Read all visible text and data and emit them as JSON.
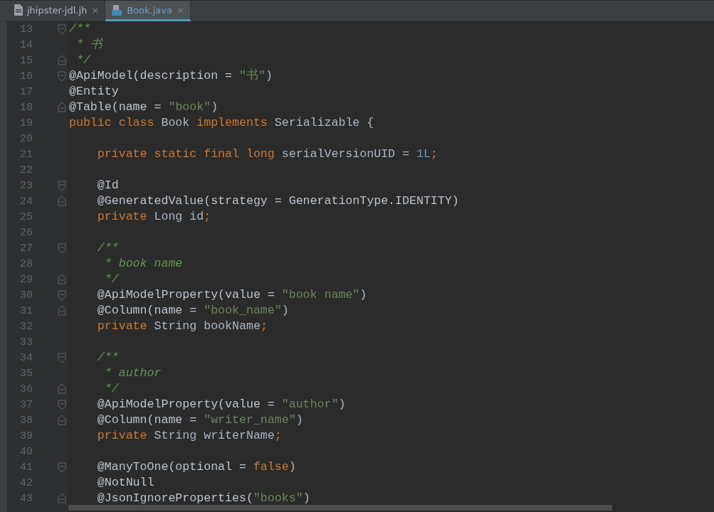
{
  "tabs": [
    {
      "label": "jhipster-jdl.jh",
      "kind": "text",
      "selected": false,
      "close": "×"
    },
    {
      "label": "Book.java",
      "kind": "java",
      "selected": true,
      "close": "×"
    }
  ],
  "editor": {
    "lines": [
      {
        "number": "13",
        "kind": "fold-start",
        "tokens": [
          {
            "kind": "comment",
            "text": "/**"
          }
        ]
      },
      {
        "number": "14",
        "kind": "plain",
        "tokens": [
          {
            "kind": "comment",
            "text": " * 书"
          }
        ]
      },
      {
        "number": "15",
        "kind": "fold-end",
        "tokens": [
          {
            "kind": "comment",
            "text": " */"
          }
        ]
      },
      {
        "number": "16",
        "kind": "fold-start",
        "tokens": [
          {
            "kind": "annotation",
            "text": "@ApiModel(description = "
          },
          {
            "kind": "string",
            "text": "\"书\""
          },
          {
            "kind": "plain",
            "text": ")"
          }
        ]
      },
      {
        "number": "17",
        "kind": "plain",
        "tokens": [
          {
            "kind": "annotation",
            "text": "@Entity"
          }
        ]
      },
      {
        "number": "18",
        "kind": "fold-end",
        "tokens": [
          {
            "kind": "annotation",
            "text": "@Table(name = "
          },
          {
            "kind": "string",
            "text": "\"book\""
          },
          {
            "kind": "plain",
            "text": ")"
          }
        ]
      },
      {
        "number": "19",
        "kind": "plain",
        "tokens": [
          {
            "kind": "keyword",
            "text": "public class "
          },
          {
            "kind": "plain",
            "text": "Book "
          },
          {
            "kind": "keyword",
            "text": "implements "
          },
          {
            "kind": "plain",
            "text": "Serializable {"
          }
        ]
      },
      {
        "number": "20",
        "kind": "plain"
      },
      {
        "number": "21",
        "kind": "plain",
        "tokens": [
          {
            "kind": "keyword",
            "text": "    private static final long "
          },
          {
            "kind": "plain",
            "text": "serialVersionUID = "
          },
          {
            "kind": "number",
            "text": "1L"
          },
          {
            "kind": "keyword",
            "text": ";"
          }
        ]
      },
      {
        "number": "22",
        "kind": "plain"
      },
      {
        "number": "23",
        "kind": "fold-start",
        "tokens": [
          {
            "kind": "annotation",
            "text": "    @Id"
          }
        ]
      },
      {
        "number": "24",
        "kind": "fold-end",
        "tokens": [
          {
            "kind": "annotation",
            "text": "    @GeneratedValue(strategy = GenerationType.IDENTITY)"
          }
        ]
      },
      {
        "number": "25",
        "kind": "plain",
        "tokens": [
          {
            "kind": "keyword",
            "text": "    private "
          },
          {
            "kind": "plain",
            "text": "Long id"
          },
          {
            "kind": "keyword",
            "text": ";"
          }
        ]
      },
      {
        "number": "26",
        "kind": "plain"
      },
      {
        "number": "27",
        "kind": "fold-start",
        "tokens": [
          {
            "kind": "comment",
            "text": "    /**"
          }
        ]
      },
      {
        "number": "28",
        "kind": "plain",
        "tokens": [
          {
            "kind": "comment",
            "text": "     * book name"
          }
        ]
      },
      {
        "number": "29",
        "kind": "fold-end",
        "tokens": [
          {
            "kind": "comment",
            "text": "     */"
          }
        ]
      },
      {
        "number": "30",
        "kind": "fold-start",
        "tokens": [
          {
            "kind": "annotation",
            "text": "    @ApiModelProperty(value = "
          },
          {
            "kind": "string",
            "text": "\"book name\""
          },
          {
            "kind": "plain",
            "text": ")"
          }
        ]
      },
      {
        "number": "31",
        "kind": "fold-end",
        "tokens": [
          {
            "kind": "annotation",
            "text": "    @Column(name = "
          },
          {
            "kind": "string",
            "text": "\"book_name\""
          },
          {
            "kind": "plain",
            "text": ")"
          }
        ]
      },
      {
        "number": "32",
        "kind": "plain",
        "tokens": [
          {
            "kind": "keyword",
            "text": "    private "
          },
          {
            "kind": "plain",
            "text": "String bookName"
          },
          {
            "kind": "keyword",
            "text": ";"
          }
        ]
      },
      {
        "number": "33",
        "kind": "plain"
      },
      {
        "number": "34",
        "kind": "fold-start",
        "tokens": [
          {
            "kind": "comment",
            "text": "    /**"
          }
        ]
      },
      {
        "number": "35",
        "kind": "plain",
        "tokens": [
          {
            "kind": "comment",
            "text": "     * author"
          }
        ]
      },
      {
        "number": "36",
        "kind": "fold-end",
        "tokens": [
          {
            "kind": "comment",
            "text": "     */"
          }
        ]
      },
      {
        "number": "37",
        "kind": "fold-start",
        "tokens": [
          {
            "kind": "annotation",
            "text": "    @ApiModelProperty(value = "
          },
          {
            "kind": "string",
            "text": "\"author\""
          },
          {
            "kind": "plain",
            "text": ")"
          }
        ]
      },
      {
        "number": "38",
        "kind": "fold-end",
        "tokens": [
          {
            "kind": "annotation",
            "text": "    @Column(name = "
          },
          {
            "kind": "string",
            "text": "\"writer_name\""
          },
          {
            "kind": "plain",
            "text": ")"
          }
        ]
      },
      {
        "number": "39",
        "kind": "plain",
        "tokens": [
          {
            "kind": "keyword",
            "text": "    private "
          },
          {
            "kind": "plain",
            "text": "String writerName"
          },
          {
            "kind": "keyword",
            "text": ";"
          }
        ]
      },
      {
        "number": "40",
        "kind": "plain"
      },
      {
        "number": "41",
        "kind": "fold-start",
        "tokens": [
          {
            "kind": "annotation",
            "text": "    @ManyToOne(optional = "
          },
          {
            "kind": "keyword",
            "text": "false"
          },
          {
            "kind": "plain",
            "text": ")"
          }
        ]
      },
      {
        "number": "42",
        "kind": "plain",
        "tokens": [
          {
            "kind": "annotation",
            "text": "    @NotNull"
          }
        ]
      },
      {
        "number": "43",
        "kind": "fold-end",
        "tokens": [
          {
            "kind": "annotation",
            "text": "    @JsonIgnoreProperties("
          },
          {
            "kind": "string",
            "text": "\"books\""
          },
          {
            "kind": "plain",
            "text": ")"
          }
        ]
      }
    ]
  }
}
